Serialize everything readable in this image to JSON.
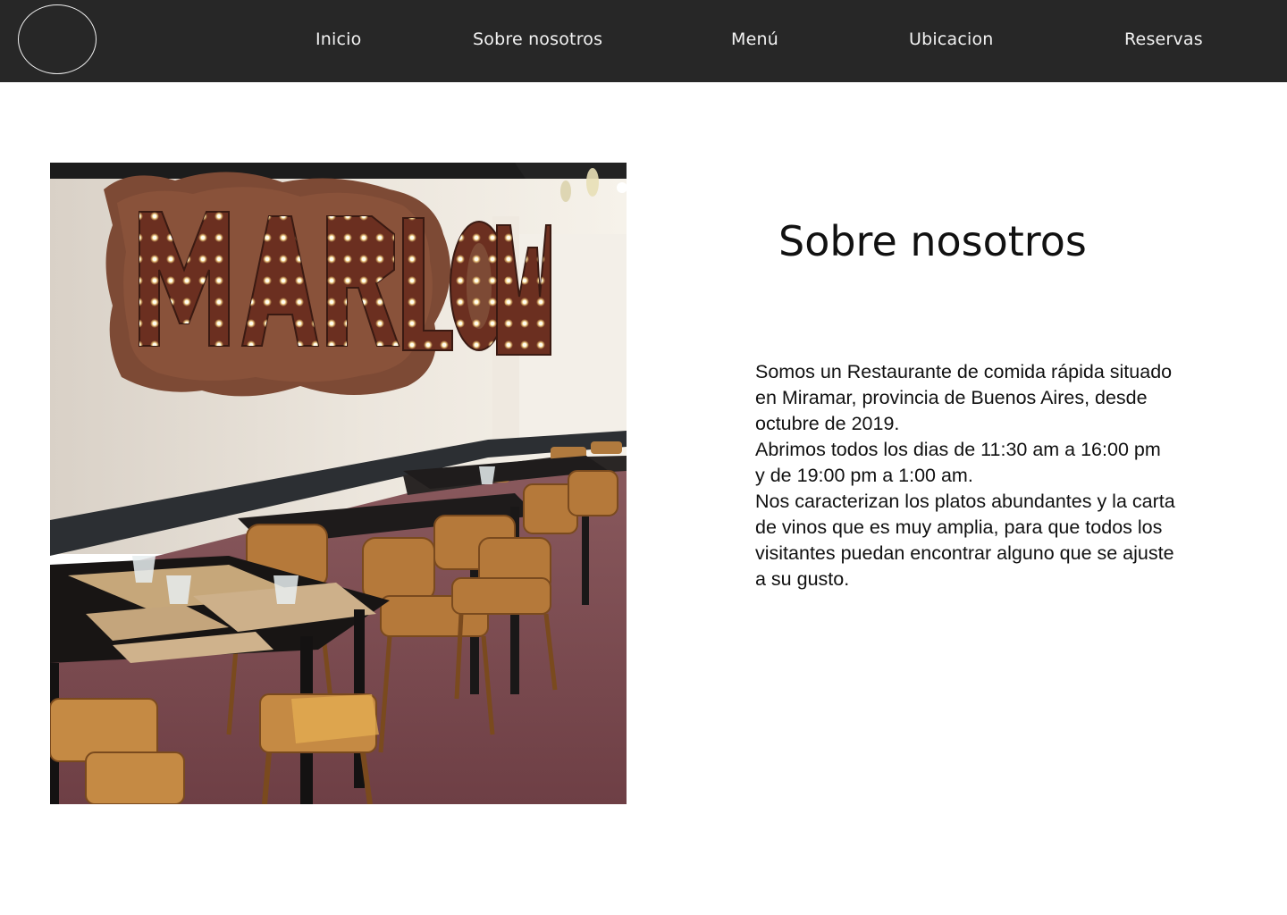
{
  "nav": {
    "items": [
      {
        "label": "Inicio"
      },
      {
        "label": "Sobre nosotros"
      },
      {
        "label": "Menú"
      },
      {
        "label": "Ubicacion"
      },
      {
        "label": "Reservas"
      }
    ]
  },
  "main": {
    "photo": {
      "sign_text": "MARLOW"
    },
    "title": "Sobre nosotros",
    "paragraphs": [
      "Somos un Restaurante de comida rápida situado en Miramar, provincia de Buenos Aires, desde octubre de 2019.",
      "Abrimos todos los dias de 11:30 am a 16:00 pm y de 19:00 pm a 1:00 am.",
      "Nos caracterizan los platos abundantes y la carta de vinos que es muy amplia, para que todos los visitantes puedan encontrar alguno que se ajuste a su gusto."
    ]
  },
  "colors": {
    "navbar_bg": "#272727",
    "nav_text": "#f2f2f2",
    "body_text": "#111111",
    "background": "#ffffff"
  }
}
